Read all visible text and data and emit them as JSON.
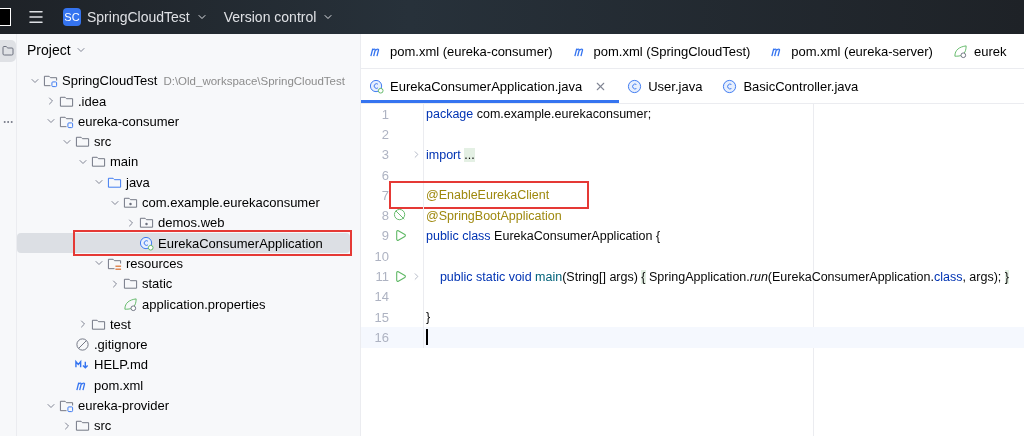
{
  "title_bar": {
    "project_badge": "SC",
    "project": "SpringCloudTest",
    "vcs": "Version control"
  },
  "project_panel": {
    "title": "Project",
    "tree": [
      {
        "label": "SpringCloudTest",
        "path": "D:\\Old_workspace\\SpringCloudTest",
        "kind": "module",
        "expanded": true,
        "selected": false,
        "annotated": false,
        "children": [
          {
            "label": ".idea",
            "kind": "folder",
            "expanded": false,
            "selected": false,
            "annotated": false
          },
          {
            "label": "eureka-consumer",
            "kind": "module",
            "expanded": true,
            "selected": false,
            "annotated": false,
            "children": [
              {
                "label": "src",
                "kind": "folder",
                "expanded": true,
                "selected": false,
                "annotated": false,
                "children": [
                  {
                    "label": "main",
                    "kind": "folder",
                    "expanded": true,
                    "selected": false,
                    "annotated": false,
                    "children": [
                      {
                        "label": "java",
                        "kind": "source",
                        "expanded": true,
                        "selected": false,
                        "annotated": false,
                        "children": [
                          {
                            "label": "com.example.eurekaconsumer",
                            "kind": "package",
                            "expanded": true,
                            "selected": false,
                            "annotated": false,
                            "children": [
                              {
                                "label": "demos.web",
                                "kind": "package",
                                "expanded": false,
                                "selected": false,
                                "annotated": false
                              },
                              {
                                "label": "EurekaConsumerApplication",
                                "kind": "springclass",
                                "selected": true,
                                "annotated": true
                              }
                            ]
                          }
                        ]
                      },
                      {
                        "label": "resources",
                        "kind": "resources",
                        "expanded": true,
                        "selected": false,
                        "annotated": false,
                        "children": [
                          {
                            "label": "static",
                            "kind": "folder",
                            "expanded": false,
                            "selected": false,
                            "annotated": false
                          },
                          {
                            "label": "application.properties",
                            "kind": "spring",
                            "selected": false,
                            "annotated": false
                          }
                        ]
                      }
                    ]
                  },
                  {
                    "label": "test",
                    "kind": "folder",
                    "expanded": false,
                    "selected": false,
                    "annotated": false
                  }
                ]
              },
              {
                "label": ".gitignore",
                "kind": "ignore",
                "selected": false,
                "annotated": false
              },
              {
                "label": "HELP.md",
                "kind": "markdown",
                "selected": false,
                "annotated": false
              },
              {
                "label": "pom.xml",
                "kind": "maven",
                "selected": false,
                "annotated": false
              }
            ]
          },
          {
            "label": "eureka-provider",
            "kind": "module",
            "expanded": true,
            "selected": false,
            "annotated": false,
            "children": [
              {
                "label": "src",
                "kind": "folder",
                "expanded": false,
                "selected": false,
                "annotated": false
              }
            ]
          }
        ]
      }
    ]
  },
  "editor": {
    "tab_rows": [
      [
        {
          "label": "pom.xml (eureka-consumer)",
          "kind": "maven",
          "selected": false,
          "closable": false
        },
        {
          "label": "pom.xml (SpringCloudTest)",
          "kind": "maven",
          "selected": false,
          "closable": false
        },
        {
          "label": "pom.xml (eureka-server)",
          "kind": "maven",
          "selected": false,
          "closable": false
        },
        {
          "label": "eurek",
          "kind": "spring",
          "selected": false,
          "closable": false
        }
      ],
      [
        {
          "label": "EurekaConsumerApplication.java",
          "kind": "springclass",
          "selected": true,
          "closable": true
        },
        {
          "label": "User.java",
          "kind": "class",
          "selected": false,
          "closable": false
        },
        {
          "label": "BasicController.java",
          "kind": "class",
          "selected": false,
          "closable": false
        }
      ]
    ],
    "lines": [
      {
        "number": "1",
        "kind": "plain",
        "tokens": [
          {
            "kind": "kw",
            "text": "package"
          },
          {
            "kind": "plain",
            "text": " com.example.eurekaconsumer;"
          }
        ]
      },
      {
        "number": "2",
        "kind": "plain"
      },
      {
        "number": "3",
        "kind": "plain",
        "fold": true,
        "tokens": [
          {
            "kind": "kw",
            "text": "import "
          },
          {
            "kind": "folded",
            "text": "..."
          }
        ]
      },
      {
        "number": "6",
        "kind": "plain"
      },
      {
        "number": "7",
        "kind": "plain",
        "annotated": true,
        "tokens": [
          {
            "kind": "annotation",
            "text": "@EnableEurekaClient"
          }
        ]
      },
      {
        "number": "8",
        "kind": "bean",
        "tokens": [
          {
            "kind": "annotation",
            "text": "@SpringBootApplication"
          }
        ]
      },
      {
        "number": "9",
        "kind": "run",
        "tokens": [
          {
            "kind": "kw",
            "text": "public class"
          },
          {
            "kind": "plain",
            "text": " EurekaConsumerApplication {"
          }
        ]
      },
      {
        "number": "10",
        "kind": "plain"
      },
      {
        "number": "11",
        "kind": "run",
        "fold": true,
        "tokens": [
          {
            "kind": "kw",
            "text": "    public static void "
          },
          {
            "kind": "method",
            "text": "main"
          },
          {
            "kind": "plain",
            "text": "(String[] args) "
          },
          {
            "kind": "folded",
            "text": "{"
          },
          {
            "kind": "plain",
            "text": " SpringApplication."
          },
          {
            "kind": "italic",
            "text": "run"
          },
          {
            "kind": "plain",
            "text": "(EurekaConsumerApplication."
          },
          {
            "kind": "kw",
            "text": "class"
          },
          {
            "kind": "plain",
            "text": ", args); "
          },
          {
            "kind": "folded",
            "text": "}"
          }
        ]
      },
      {
        "number": "14",
        "kind": "plain"
      },
      {
        "number": "15",
        "kind": "plain",
        "tokens": [
          {
            "kind": "plain",
            "text": "}"
          }
        ]
      },
      {
        "number": "16",
        "kind": "plain",
        "current": true
      }
    ]
  }
}
